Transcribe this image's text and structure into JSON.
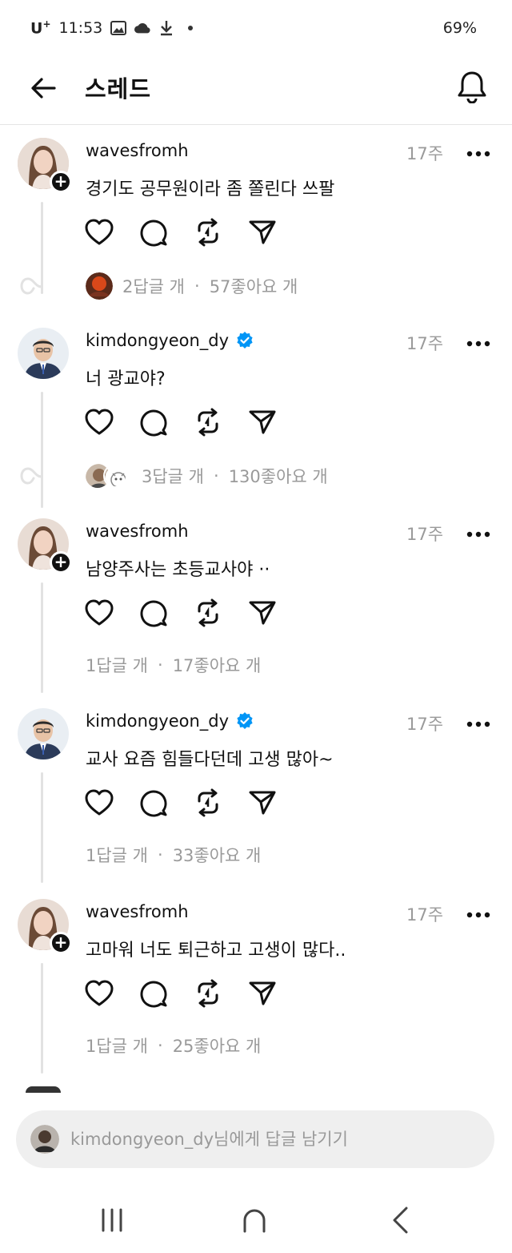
{
  "status_bar": {
    "carrier": "U",
    "carrier_sup": "+",
    "time": "11:53",
    "battery": "69%",
    "icons": [
      "gallery-icon",
      "cloud-icon",
      "download-icon",
      "dot-icon"
    ]
  },
  "header": {
    "title": "스레드",
    "back_icon": "arrow-left-icon",
    "notification_icon": "bell-icon"
  },
  "posts": [
    {
      "username": "wavesfromh",
      "verified": false,
      "time": "17주",
      "text": "경기도 공무원이라 좀 쫄린다 쓰팔",
      "replies": "2답글 개",
      "separator": "·",
      "likes": "57좋아요 개"
    },
    {
      "username": "kimdongyeon_dy",
      "verified": true,
      "time": "17주",
      "text": "너 광교야?",
      "replies": "3답글 개",
      "separator": "·",
      "likes": "130좋아요 개"
    },
    {
      "username": "wavesfromh",
      "verified": false,
      "time": "17주",
      "text": "남양주사는 초등교사야 ··",
      "replies": "1답글 개",
      "separator": "·",
      "likes": "17좋아요 개"
    },
    {
      "username": "kimdongyeon_dy",
      "verified": true,
      "time": "17주",
      "text": "교사 요즘 힘들다던데 고생 많아~",
      "replies": "1답글 개",
      "separator": "·",
      "likes": "33좋아요 개"
    },
    {
      "username": "wavesfromh",
      "verified": false,
      "time": "17주",
      "text": "고마워 너도 퇴근하고 고생이 많다..",
      "replies": "1답글 개",
      "separator": "·",
      "likes": "25좋아요 개"
    }
  ],
  "post_actions": [
    "heart-icon",
    "comment-icon",
    "repost-icon",
    "share-icon"
  ],
  "reply_bar": {
    "placeholder": "kimdongyeon_dy님에게 답글 남기기"
  },
  "nav_bar": {
    "recent_icon": "recent-apps-icon",
    "home_icon": "home-icon",
    "back_icon": "back-chevron-icon"
  },
  "colors": {
    "verified_blue": "#0095f6",
    "muted_text": "#9a9a9a",
    "thread_line": "#e2e2e2",
    "reply_bar_bg": "#efefef"
  }
}
